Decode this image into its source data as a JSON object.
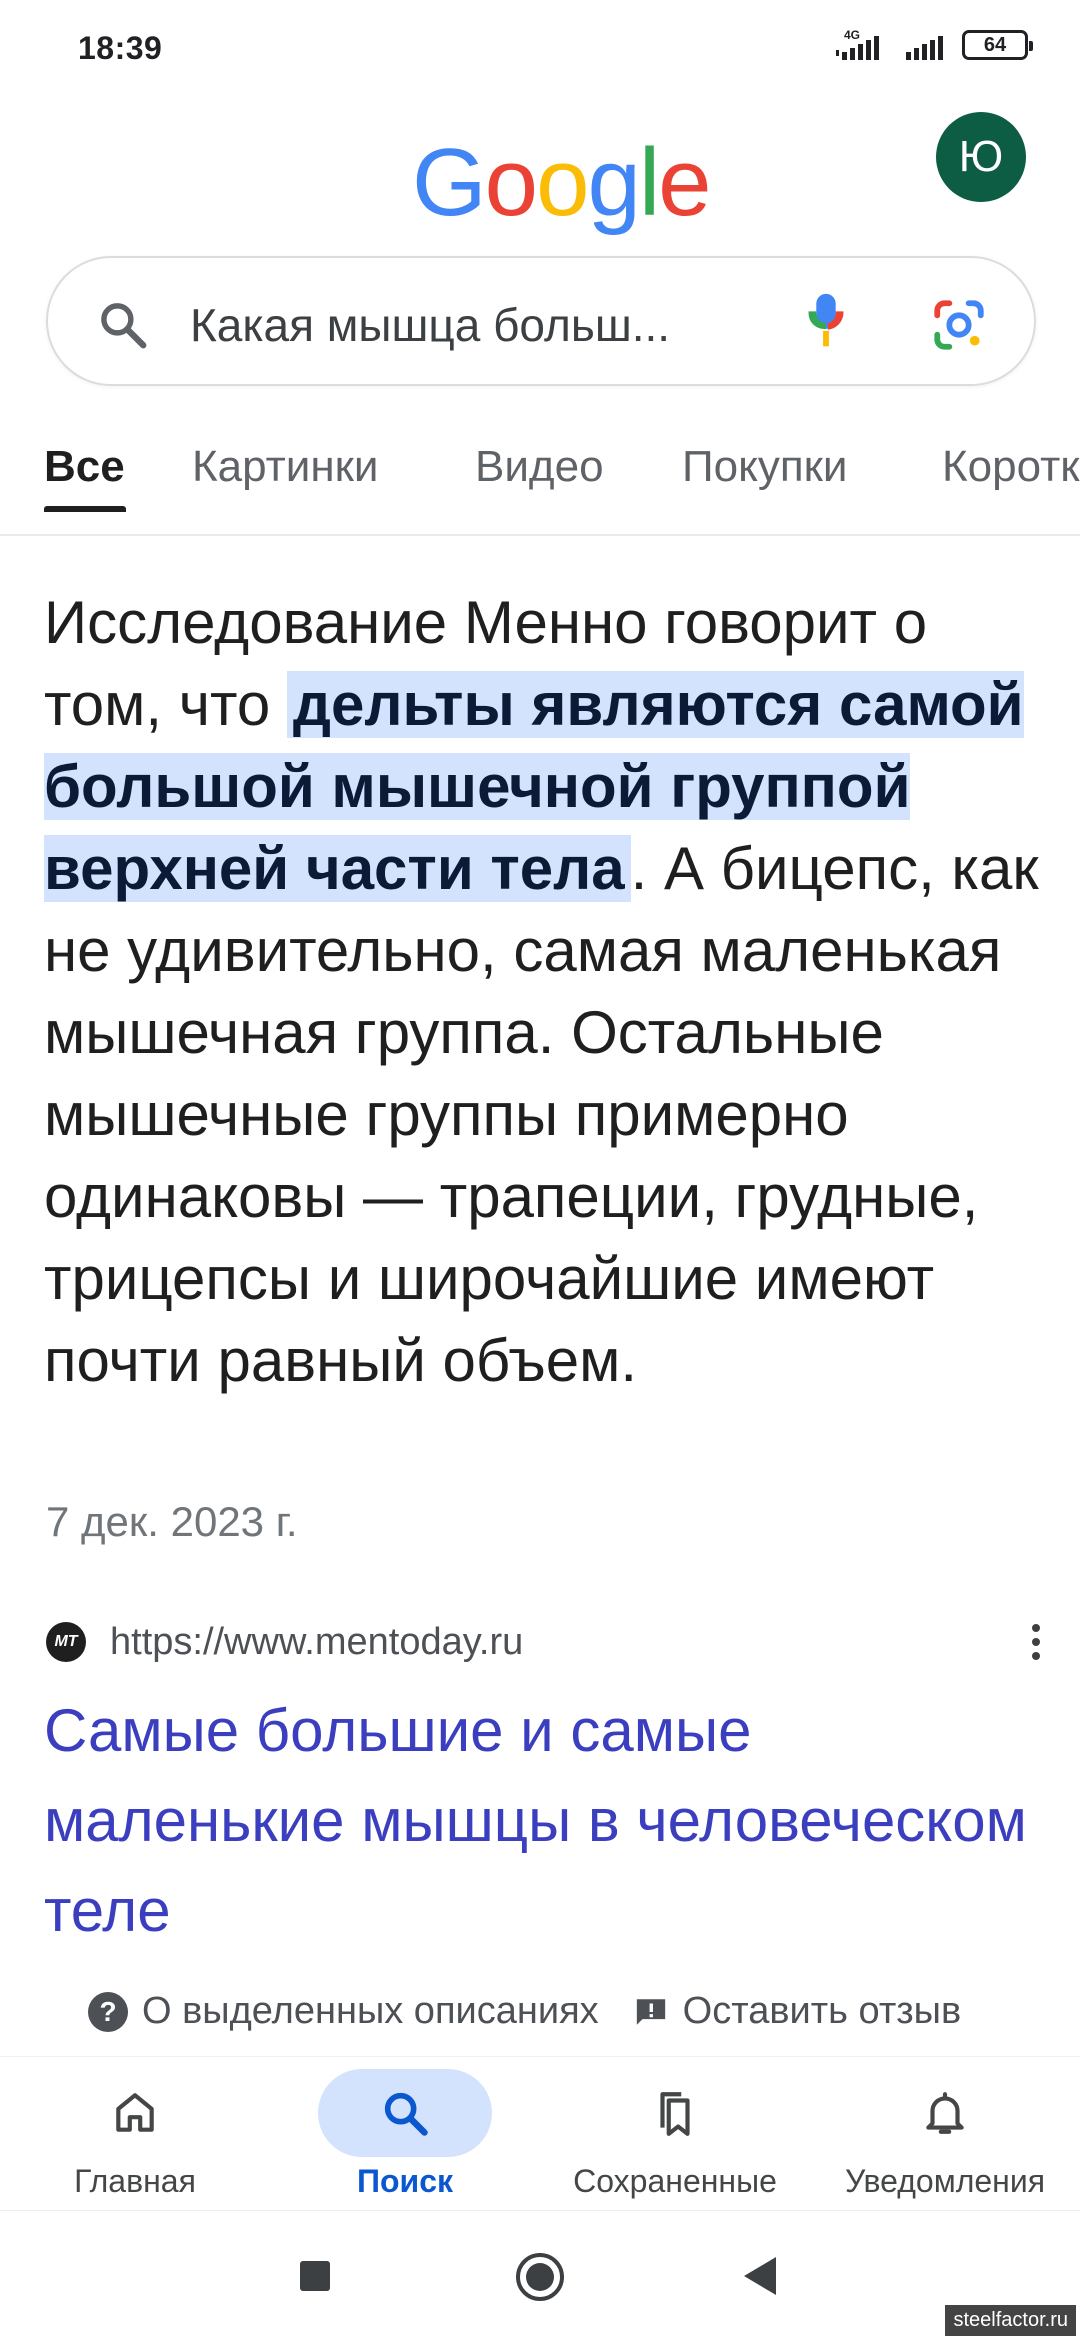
{
  "status_bar": {
    "time": "18:39",
    "network": "4G",
    "battery": "64"
  },
  "header": {
    "logo_text": "Google",
    "avatar_letter": "Ю"
  },
  "search": {
    "query": "Какая мышца больш..."
  },
  "tabs": [
    {
      "label": "Все",
      "active": true
    },
    {
      "label": "Картинки",
      "active": false
    },
    {
      "label": "Видео",
      "active": false
    },
    {
      "label": "Покупки",
      "active": false
    },
    {
      "label": "Короткие",
      "active": false
    }
  ],
  "featured_snippet": {
    "text_before": "Исследование Менно говорит о том, что ",
    "highlight": "дельты являются самой большой мышечной группой верхней части тела",
    "text_after": ". А бицепс, как не удивительно, самая маленькая мышечная группа. Остальные мышечные группы примерно одинаковы — трапеции, грудные, трицепсы и широчайшие имеют почти равный объем.",
    "date": "7 дек. 2023 г."
  },
  "result": {
    "favicon_text": "MT",
    "url": "https://www.mentoday.ru",
    "title": "Самые большие и самые маленькие мышцы в человеческом теле"
  },
  "feedback": {
    "about_label": "О выделенных описаниях",
    "feedback_label": "Оставить отзыв"
  },
  "bottom_nav": [
    {
      "label": "Главная",
      "icon": "home-icon",
      "active": false
    },
    {
      "label": "Поиск",
      "icon": "search-icon",
      "active": true
    },
    {
      "label": "Сохраненные",
      "icon": "bookmarks-icon",
      "active": false
    },
    {
      "label": "Уведомления",
      "icon": "bell-icon",
      "active": false
    }
  ],
  "watermark": "steelfactor.ru",
  "colors": {
    "highlight_bg": "#d3e3fd",
    "link": "#3b3fbf",
    "avatar_bg": "#0d5c44",
    "active_nav": "#0b57d0"
  }
}
